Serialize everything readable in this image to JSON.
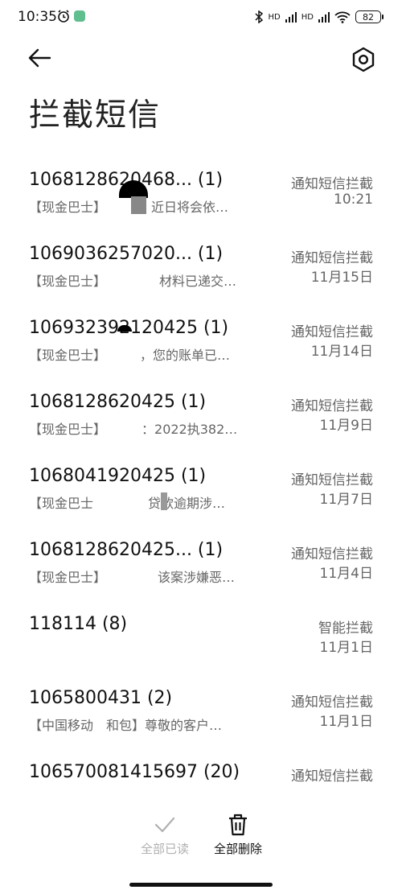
{
  "status_bar": {
    "time": "10:35",
    "signal_label": "HD",
    "battery": "82"
  },
  "header": {
    "title": "拦截短信"
  },
  "messages": [
    {
      "sender": "1068128620468... (1)",
      "preview": "【现金巴士】",
      "preview2": "，近日将会依…",
      "tag": "通知短信拦截",
      "time": "10:21"
    },
    {
      "sender": "1069036257020... (1)",
      "preview": "【现金巴士】",
      "preview2": "材料已递交…",
      "tag": "通知短信拦截",
      "time": "11月15日"
    },
    {
      "sender": "106932392120425 (1)",
      "preview": "【现金巴士】",
      "preview2": "，您的账单已…",
      "tag": "通知短信拦截",
      "time": "11月14日"
    },
    {
      "sender": "1068128620425 (1)",
      "preview": "【现金巴士】",
      "preview2": "：2022执382…",
      "tag": "通知短信拦截",
      "time": "11月9日"
    },
    {
      "sender": "1068041920425 (1)",
      "preview": "【现金巴士",
      "preview2": "贷款逾期涉…",
      "tag": "通知短信拦截",
      "time": "11月7日"
    },
    {
      "sender": "1068128620425... (1)",
      "preview": "【现金巴士】",
      "preview2": "该案涉嫌恶…",
      "tag": "通知短信拦截",
      "time": "11月4日"
    },
    {
      "sender": "118114 (8)",
      "preview": "",
      "preview2": "",
      "tag": "智能拦截",
      "time": "11月1日"
    },
    {
      "sender": "1065800431 (2)",
      "preview": "【中国移动　和包】尊敬的客户…",
      "preview2": "",
      "tag": "通知短信拦截",
      "time": "11月1日"
    },
    {
      "sender": "106570081415697 (20)",
      "preview": "",
      "preview2": "",
      "tag": "通知短信拦截",
      "time": ""
    }
  ],
  "bottom_actions": {
    "read_all": "全部已读",
    "delete_all": "全部删除"
  },
  "icons": [
    "back-arrow-icon",
    "settings-icon",
    "check-icon",
    "trash-icon",
    "alarm-icon",
    "bluetooth-icon",
    "wifi-icon",
    "battery-icon"
  ],
  "colors": {
    "accent": "#111111",
    "muted": "#666666",
    "disabled": "#b0b0b0"
  }
}
